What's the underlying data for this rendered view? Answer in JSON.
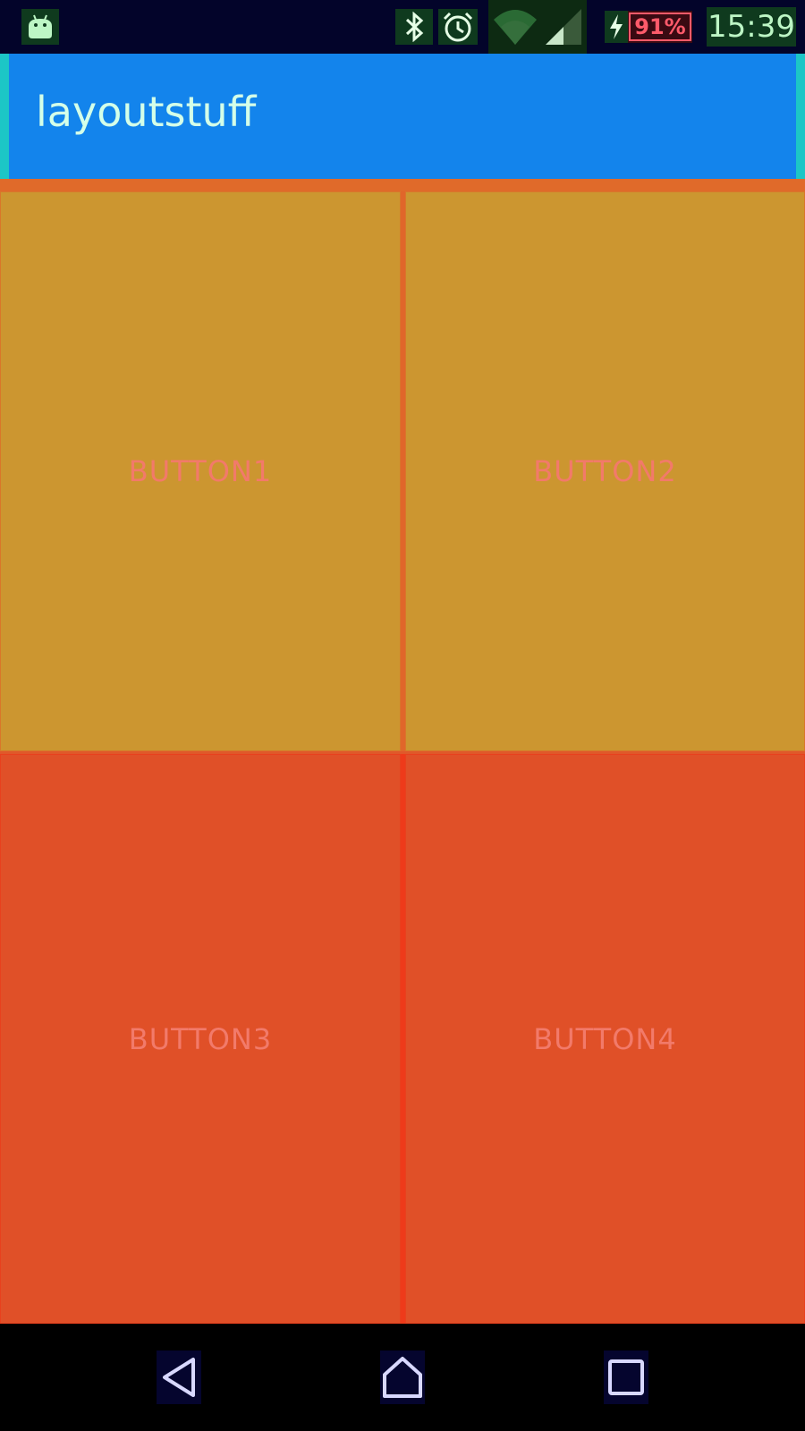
{
  "status_bar": {
    "time": "15:39",
    "battery": "91%",
    "icons": [
      "android-icon",
      "bluetooth-icon",
      "alarm-icon",
      "wifi-icon",
      "signal-icon",
      "charging-icon"
    ]
  },
  "app_bar": {
    "title": "layoutstuff"
  },
  "buttons": [
    {
      "label": "BUTTON1"
    },
    {
      "label": "BUTTON2"
    },
    {
      "label": "BUTTON3"
    },
    {
      "label": "BUTTON4"
    }
  ],
  "nav_bar": {
    "icons": [
      "back-icon",
      "home-icon",
      "recent-apps-icon"
    ]
  },
  "colors": {
    "app_bar": "#1384ec",
    "button_top": "#cc9630",
    "button_bottom": "#e05028",
    "button_text": "#f27a6a",
    "status_bar": "#03042a"
  }
}
